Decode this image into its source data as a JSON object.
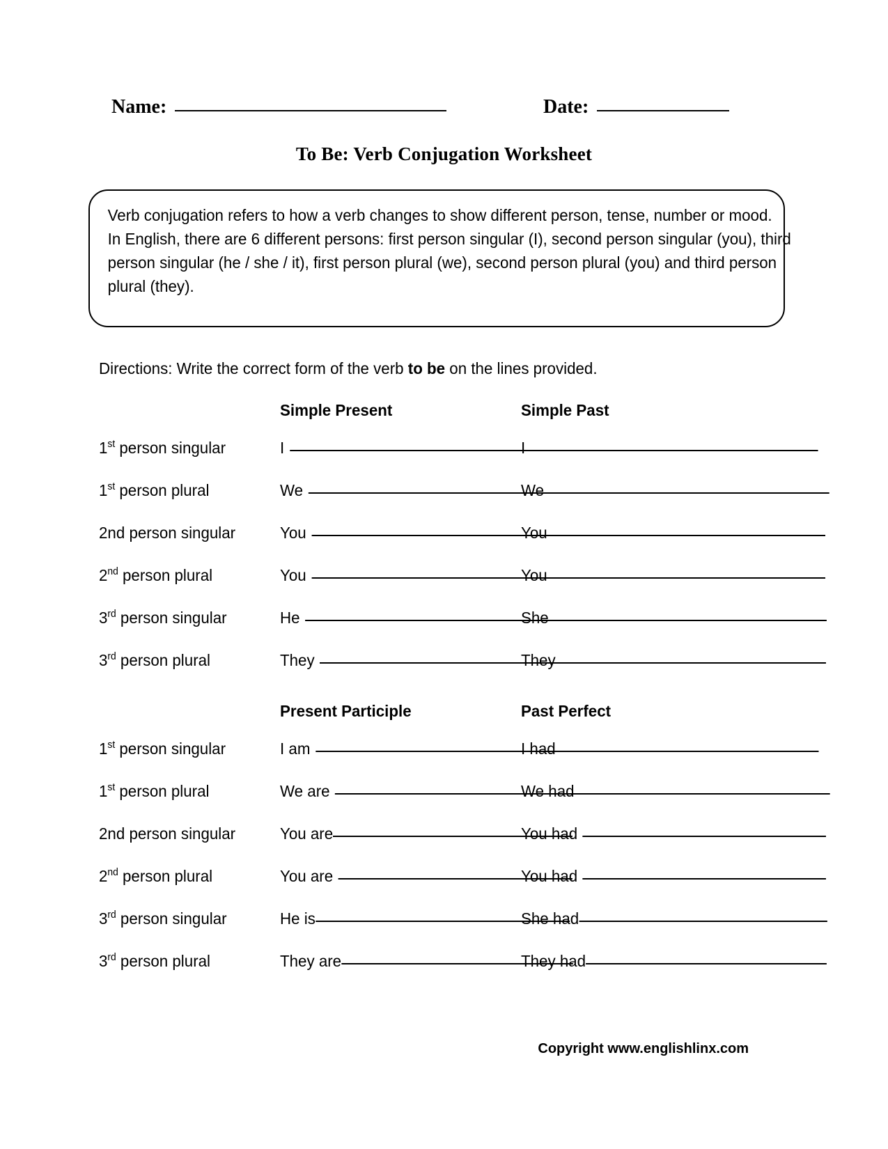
{
  "header": {
    "name_label": "Name:",
    "date_label": "Date:"
  },
  "title": "To Be: Verb Conjugation Worksheet",
  "info_box": {
    "paragraph_1": "Verb conjugation refers to how a verb changes to show different person, tense, number or mood.",
    "paragraph_2": "In English, there are 6 different persons: first person singular (I), second person singular (you), third person singular (he / she / it), first person plural (we), second person plural (you) and third person plural (they)."
  },
  "directions": {
    "prefix": "Directions: Write the correct form of the verb ",
    "bold": "to be",
    "suffix": " on the lines provided."
  },
  "tables": [
    {
      "id": "table-1",
      "columns": [
        "Simple Present",
        "Simple Past"
      ],
      "rows": [
        {
          "person_number": "1",
          "person_ordinal": "st",
          "person_rest": " person singular",
          "present": "I",
          "past": "I"
        },
        {
          "person_number": "1",
          "person_ordinal": "st",
          "person_rest": " person plural",
          "present": "We",
          "past": "We"
        },
        {
          "person_number": "2nd",
          "person_ordinal": "",
          "person_rest": " person singular",
          "present": "You",
          "past": "You"
        },
        {
          "person_number": "2",
          "person_ordinal": "nd",
          "person_rest": " person plural",
          "present": "You",
          "past": "You"
        },
        {
          "person_number": "3",
          "person_ordinal": "rd",
          "person_rest": " person singular",
          "present": "He",
          "past": "She"
        },
        {
          "person_number": "3",
          "person_ordinal": "rd",
          "person_rest": " person plural",
          "present": "They",
          "past": "They"
        }
      ]
    },
    {
      "id": "table-2",
      "columns": [
        "Present Participle",
        "Past Perfect"
      ],
      "rows": [
        {
          "person_number": "1",
          "person_ordinal": "st",
          "person_rest": " person singular",
          "present": "I am",
          "past": "I had"
        },
        {
          "person_number": "1",
          "person_ordinal": "st",
          "person_rest": " person plural",
          "present": "We are",
          "past": "We had"
        },
        {
          "person_number": "2nd",
          "person_ordinal": "",
          "person_rest": " person singular",
          "present": "You are",
          "past": "You had"
        },
        {
          "person_number": "2",
          "person_ordinal": "nd",
          "person_rest": " person plural",
          "present": "You are",
          "past": "You had"
        },
        {
          "person_number": "3",
          "person_ordinal": "rd",
          "person_rest": " person singular",
          "present": "He is",
          "past": "She had"
        },
        {
          "person_number": "3",
          "person_ordinal": "rd",
          "person_rest": " person plural",
          "present": "They are",
          "past": "They had"
        }
      ]
    }
  ],
  "footer": "Copyright www.englishlinx.com"
}
